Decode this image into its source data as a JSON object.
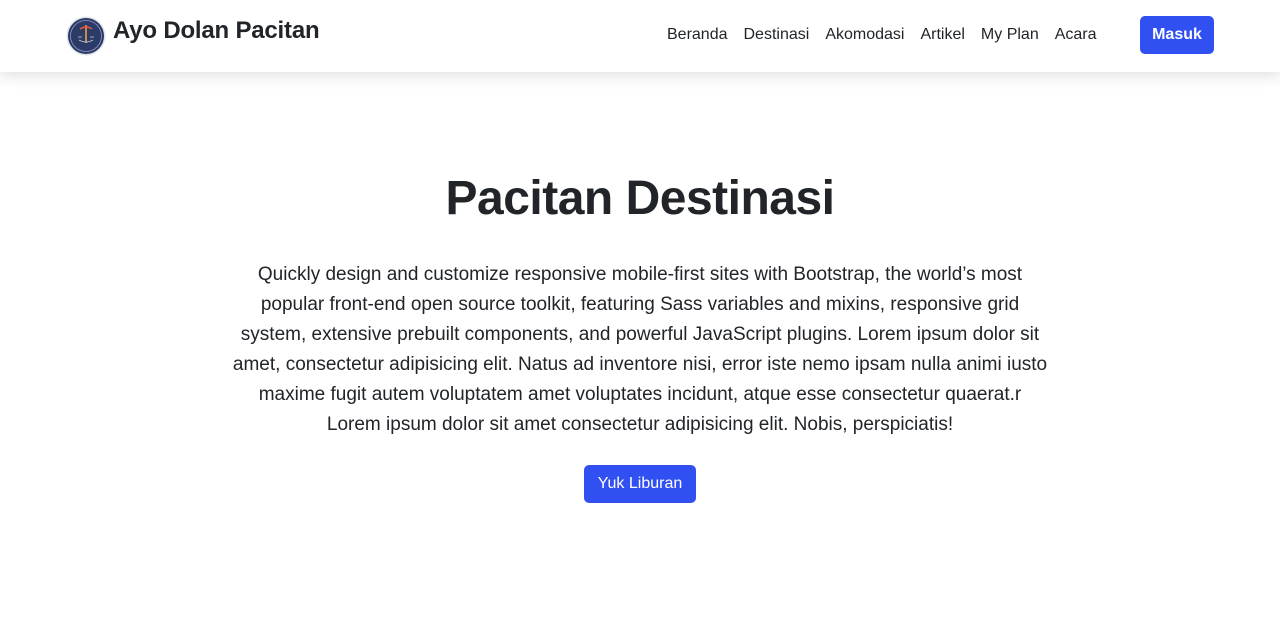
{
  "brand": {
    "name": "Ayo Dolan Pacitan"
  },
  "nav": {
    "links": [
      "Beranda",
      "Destinasi",
      "Akomodasi",
      "Artikel",
      "My Plan",
      "Acara"
    ],
    "login_label": "Masuk"
  },
  "hero": {
    "title": "Pacitan Destinasi",
    "description": "Quickly design and customize responsive mobile-first sites with Bootstrap, the world’s most popular front-end open source toolkit, featuring Sass variables and mixins, responsive grid system, extensive prebuilt components, and powerful JavaScript plugins. Lorem ipsum dolor sit amet, consectetur adipisicing elit. Natus ad inventore nisi, error iste nemo ipsam nulla animi iusto maxime fugit autem voluptatem amet voluptates incidunt, atque esse consectetur quaerat.r Lorem ipsum dolor sit amet consectetur adipisicing elit. Nobis, perspiciatis!",
    "cta_label": "Yuk Liburan"
  },
  "colors": {
    "primary": "#3150f2",
    "logo_bg": "#2b3a67",
    "text": "#212529"
  }
}
